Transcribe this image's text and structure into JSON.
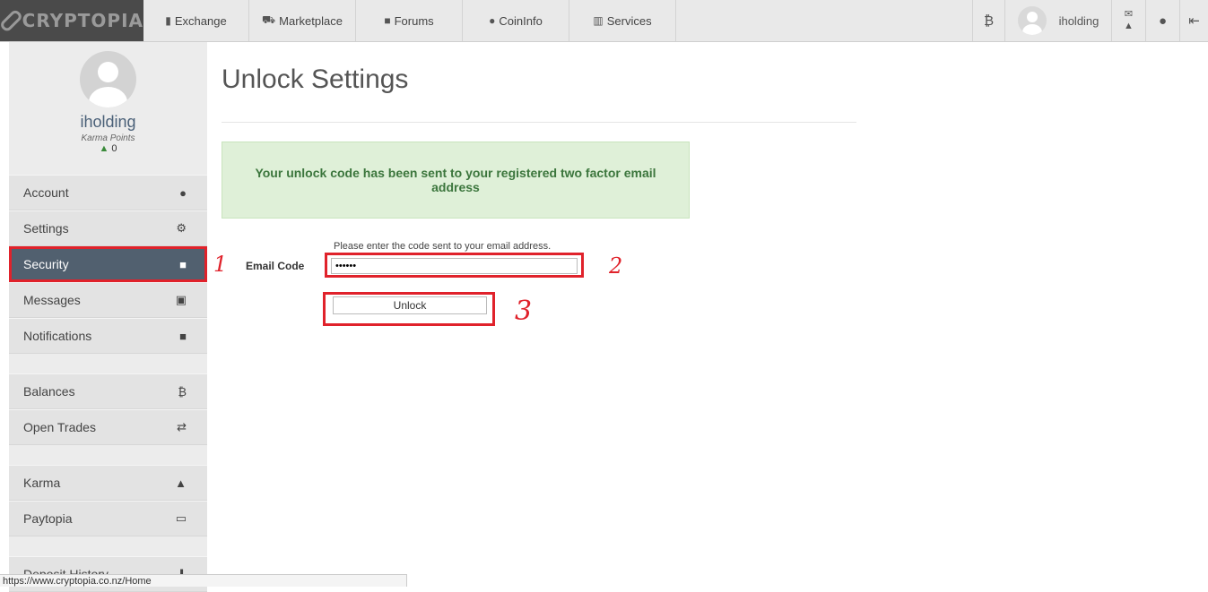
{
  "brand": {
    "name": "CRYPTOPIA"
  },
  "nav": {
    "items": [
      {
        "label": "Exchange",
        "icon": "bar-chart-icon"
      },
      {
        "label": "Marketplace",
        "icon": "cart-icon"
      },
      {
        "label": "Forums",
        "icon": "comments-icon"
      },
      {
        "label": "CoinInfo",
        "icon": "info-icon"
      },
      {
        "label": "Services",
        "icon": "bank-icon"
      }
    ],
    "right": {
      "bitcoin_icon": "₿",
      "username": "iholding"
    }
  },
  "sidebar": {
    "username": "iholding",
    "karma_label": "Karma Points",
    "karma_value": "0",
    "items": [
      {
        "label": "Account",
        "icon": "user-icon"
      },
      {
        "label": "Settings",
        "icon": "gear-icon"
      },
      {
        "label": "Security",
        "icon": "lock-icon"
      },
      {
        "label": "Messages",
        "icon": "inbox-icon"
      },
      {
        "label": "Notifications",
        "icon": "notification-icon"
      },
      {
        "label": "Balances",
        "icon": "bitcoin-icon"
      },
      {
        "label": "Open Trades",
        "icon": "exchange-icon"
      },
      {
        "label": "Karma",
        "icon": "thumbs-up-icon"
      },
      {
        "label": "Paytopia",
        "icon": "keyboard-icon"
      },
      {
        "label": "Deposit History",
        "icon": "download-icon"
      }
    ],
    "active": "Security"
  },
  "main": {
    "title": "Unlock Settings",
    "alert": "Your unlock code has been sent to your registered two factor email address",
    "help_text": "Please enter the code sent to your email address.",
    "email_code_label": "Email Code",
    "email_code_value": "••••••",
    "unlock_button": "Unlock"
  },
  "annotations": {
    "one": "1",
    "two": "2",
    "three": "3"
  },
  "status_bar": "https://www.cryptopia.co.nz/Home",
  "colors": {
    "accent_red": "#e0222b",
    "sidebar_active": "#51606f",
    "alert_bg": "#dff0d8",
    "alert_text": "#3c763d"
  }
}
